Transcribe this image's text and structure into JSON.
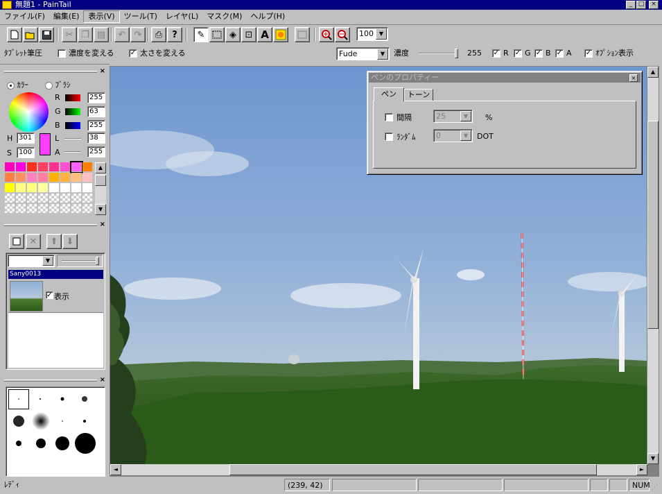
{
  "window": {
    "title": "無題1 - PainTail"
  },
  "menu": [
    "ファイル(F)",
    "編集(E)",
    "表示(V)",
    "ツール(T)",
    "レイヤ(L)",
    "マスク(M)",
    "ヘルプ(H)"
  ],
  "toolbar": {
    "zoom_value": "100"
  },
  "options": {
    "tablet_label": "ﾀﾌﾞﾚｯﾄ筆圧",
    "density_change_label": "濃度を変える",
    "density_change_checked": false,
    "size_change_label": "太さを変える",
    "size_change_checked": true,
    "brush_value": "Fude",
    "density_label": "濃度",
    "density_value": "255",
    "density_level": 1.0,
    "chk_r": "R",
    "chk_g": "G",
    "chk_b": "B",
    "chk_a": "A",
    "option_display_label": "ｵﾌﾟｼｮﾝ表示"
  },
  "color_panel": {
    "mode_color": "ｶﾗｰ",
    "mode_brush": "ﾌﾞﾗｼ",
    "r_label": "R",
    "r": "255",
    "g_label": "G",
    "g": "63",
    "b_label": "B",
    "b": "255",
    "h_label": "H",
    "h": "301",
    "s_label": "S",
    "s": "100",
    "l_label": "L",
    "l": "38",
    "a_label": "A",
    "a": "255",
    "current_color": "#ff3fff"
  },
  "palette": [
    [
      "#ff00c0",
      "#ff00e0",
      "#ff3020",
      "#ff4060",
      "#ff3090",
      "#ff50d0",
      "#ff60ff",
      "#ff8000"
    ],
    [
      "#ff8040",
      "#ff9060",
      "#ff80c0",
      "#ff80a0",
      "#ffb000",
      "#ffb040",
      "#ffc080",
      "#ffc0c0"
    ],
    [
      "#ffff00",
      "#ffff80",
      "#ffff80",
      "#ffffa0",
      "#ffffff",
      "#ffffff",
      "#ffffff",
      "#ffffff"
    ]
  ],
  "layers_panel": {
    "layer_name": "Sany0013",
    "visible_label": "表示",
    "visible_checked": true
  },
  "pen_dialog": {
    "title": "ペンのプロパティー",
    "tab_pen": "ペン",
    "tab_tone": "トーン",
    "interval_label": "間隔",
    "interval_value": "25",
    "interval_unit": "%",
    "random_label": "ﾗﾝﾀﾞﾑ",
    "random_value": "0",
    "random_unit": "DOT"
  },
  "status": {
    "ready": "ﾚﾃﾞｨ",
    "coords": "(239,  42)",
    "num": "NUM"
  }
}
